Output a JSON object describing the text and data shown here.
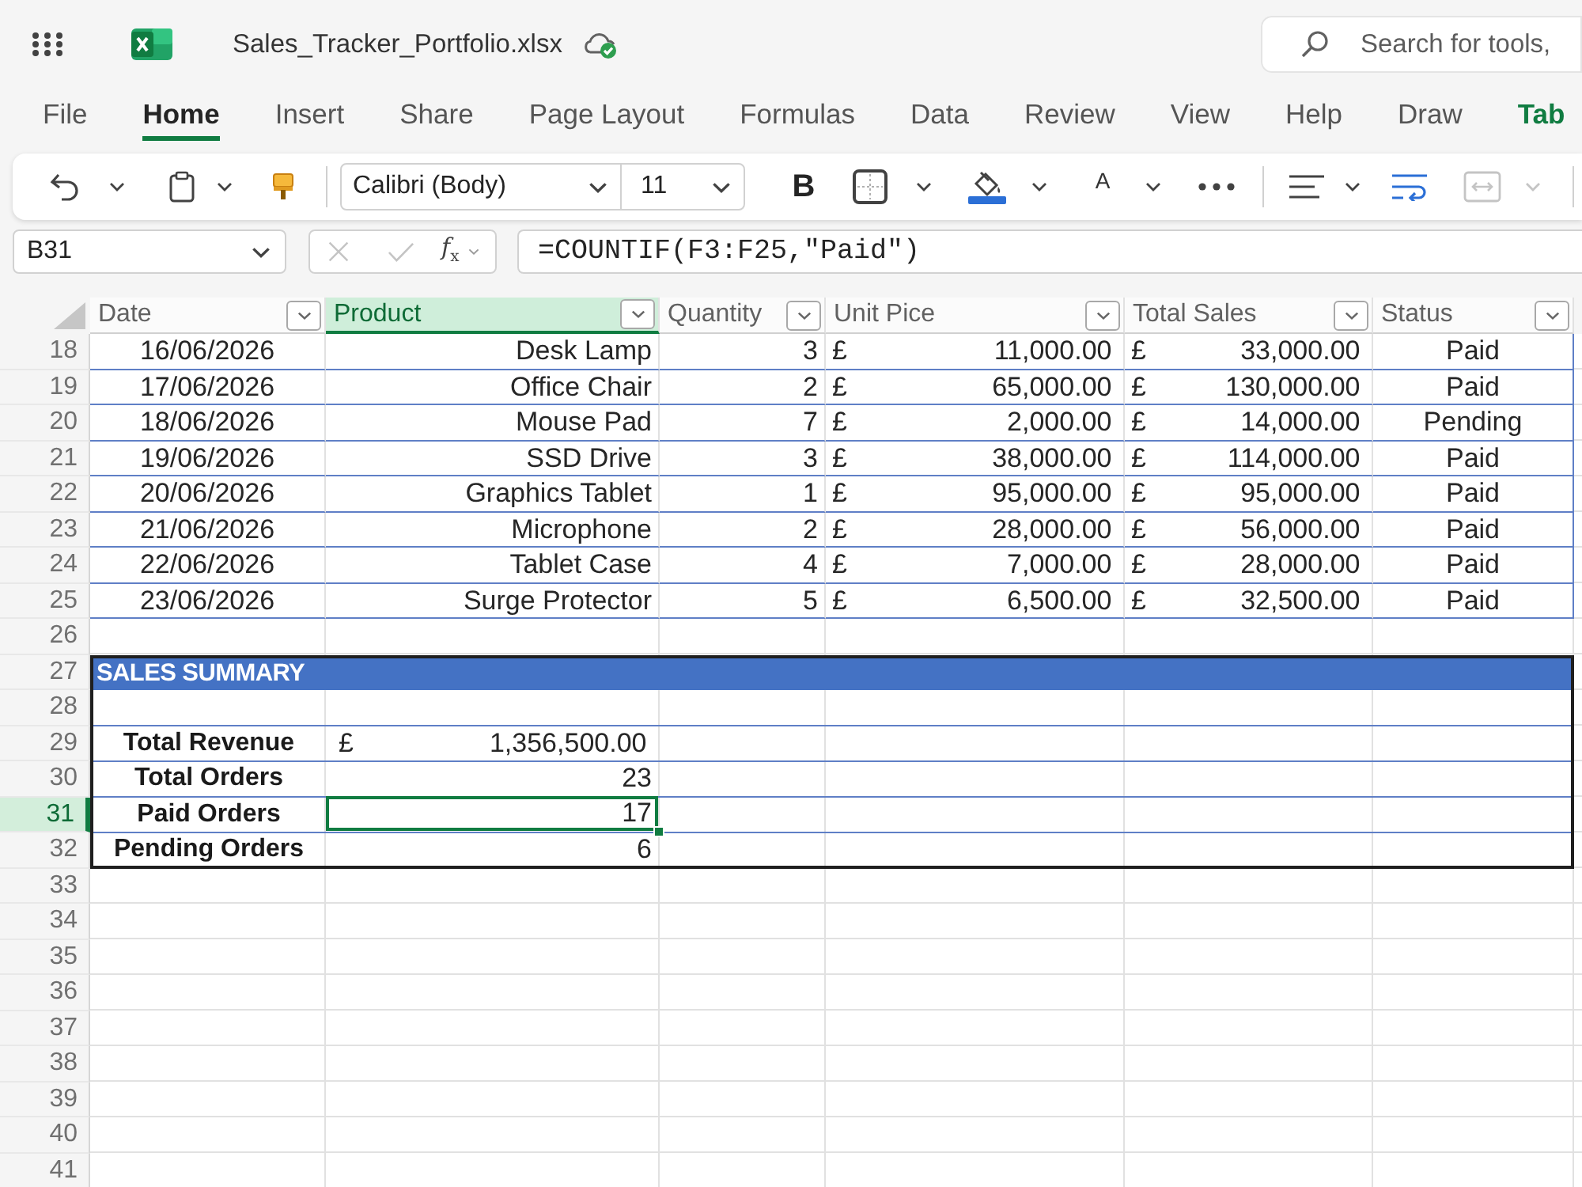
{
  "title_bar": {
    "file_name": "Sales_Tracker_Portfolio.xlsx",
    "search": {
      "placeholder": "Search for tools,"
    }
  },
  "ribbon_tabs": [
    {
      "label": "File",
      "selected": false,
      "kind": "standard"
    },
    {
      "label": "Home",
      "selected": true,
      "kind": "standard"
    },
    {
      "label": "Insert",
      "selected": false,
      "kind": "standard"
    },
    {
      "label": "Share",
      "selected": false,
      "kind": "standard"
    },
    {
      "label": "Page Layout",
      "selected": false,
      "kind": "standard"
    },
    {
      "label": "Formulas",
      "selected": false,
      "kind": "standard"
    },
    {
      "label": "Data",
      "selected": false,
      "kind": "standard"
    },
    {
      "label": "Review",
      "selected": false,
      "kind": "standard"
    },
    {
      "label": "View",
      "selected": false,
      "kind": "standard"
    },
    {
      "label": "Help",
      "selected": false,
      "kind": "standard"
    },
    {
      "label": "Draw",
      "selected": false,
      "kind": "standard"
    },
    {
      "label": "Tab",
      "selected": false,
      "kind": "contextual"
    }
  ],
  "toolbar": {
    "font_name": "Calibri (Body)",
    "font_size": "11",
    "bold_label": "B",
    "font_color_label": "A",
    "merge": {
      "disabled": true
    }
  },
  "formula_bar": {
    "name_box": "B31",
    "confirm_buttons": {
      "disabled": true
    },
    "function_label": "*f*$_{x}$",
    "formula": "=COUNTIF(F3:F25,\"Paid\")"
  },
  "sheet": {
    "columns": [
      {
        "label": "Date",
        "selected": false
      },
      {
        "label": "Product",
        "selected": true
      },
      {
        "label": "Quantity",
        "selected": false
      },
      {
        "label": "Unit Pice",
        "selected": false
      },
      {
        "label": "Total Sales",
        "selected": false
      },
      {
        "label": "Status",
        "selected": false
      }
    ],
    "row_headers": [
      {
        "label": "18",
        "selected": false
      },
      {
        "label": "19",
        "selected": false
      },
      {
        "label": "20",
        "selected": false
      },
      {
        "label": "21",
        "selected": false
      },
      {
        "label": "22",
        "selected": false
      },
      {
        "label": "23",
        "selected": false
      },
      {
        "label": "24",
        "selected": false
      },
      {
        "label": "25",
        "selected": false
      },
      {
        "label": "26",
        "selected": false
      },
      {
        "label": "27",
        "selected": false
      },
      {
        "label": "28",
        "selected": false
      },
      {
        "label": "29",
        "selected": false
      },
      {
        "label": "30",
        "selected": false
      },
      {
        "label": "31",
        "selected": true
      },
      {
        "label": "32",
        "selected": false
      },
      {
        "label": "33",
        "selected": false
      },
      {
        "label": "34",
        "selected": false
      },
      {
        "label": "35",
        "selected": false
      },
      {
        "label": "36",
        "selected": false
      },
      {
        "label": "37",
        "selected": false
      },
      {
        "label": "38",
        "selected": false
      },
      {
        "label": "39",
        "selected": false
      },
      {
        "label": "40",
        "selected": false
      },
      {
        "label": "41",
        "selected": false
      }
    ],
    "table_rows": [
      {
        "date": "16/06/2026",
        "product": "Desk Lamp",
        "quantity": "3",
        "unit_price": {
          "currency": "£",
          "amount": "11,000.00"
        },
        "total_sales": {
          "currency": "£",
          "amount": "33,000.00"
        },
        "status": "Paid"
      },
      {
        "date": "17/06/2026",
        "product": "Office Chair",
        "quantity": "2",
        "unit_price": {
          "currency": "£",
          "amount": "65,000.00"
        },
        "total_sales": {
          "currency": "£",
          "amount": "130,000.00"
        },
        "status": "Paid"
      },
      {
        "date": "18/06/2026",
        "product": "Mouse Pad",
        "quantity": "7",
        "unit_price": {
          "currency": "£",
          "amount": "2,000.00"
        },
        "total_sales": {
          "currency": "£",
          "amount": "14,000.00"
        },
        "status": "Pending"
      },
      {
        "date": "19/06/2026",
        "product": "SSD Drive",
        "quantity": "3",
        "unit_price": {
          "currency": "£",
          "amount": "38,000.00"
        },
        "total_sales": {
          "currency": "£",
          "amount": "114,000.00"
        },
        "status": "Paid"
      },
      {
        "date": "20/06/2026",
        "product": "Graphics Tablet",
        "quantity": "1",
        "unit_price": {
          "currency": "£",
          "amount": "95,000.00"
        },
        "total_sales": {
          "currency": "£",
          "amount": "95,000.00"
        },
        "status": "Paid"
      },
      {
        "date": "21/06/2026",
        "product": "Microphone",
        "quantity": "2",
        "unit_price": {
          "currency": "£",
          "amount": "28,000.00"
        },
        "total_sales": {
          "currency": "£",
          "amount": "56,000.00"
        },
        "status": "Paid"
      },
      {
        "date": "22/06/2026",
        "product": "Tablet Case",
        "quantity": "4",
        "unit_price": {
          "currency": "£",
          "amount": "7,000.00"
        },
        "total_sales": {
          "currency": "£",
          "amount": "28,000.00"
        },
        "status": "Paid"
      },
      {
        "date": "23/06/2026",
        "product": "Surge Protector",
        "quantity": "5",
        "unit_price": {
          "currency": "£",
          "amount": "6,500.00"
        },
        "total_sales": {
          "currency": "£",
          "amount": "32,500.00"
        },
        "status": "Paid"
      }
    ],
    "summary": {
      "title": "SALES SUMMARY",
      "items": [
        {
          "label": "Total Revenue",
          "currency": "£",
          "value": "1,356,500.00",
          "selected": false
        },
        {
          "label": "Total Orders",
          "value": "23",
          "selected": false
        },
        {
          "label": "Paid Orders",
          "value": "17",
          "selected": true
        },
        {
          "label": "Pending Orders",
          "value": "6",
          "selected": false
        }
      ]
    }
  }
}
